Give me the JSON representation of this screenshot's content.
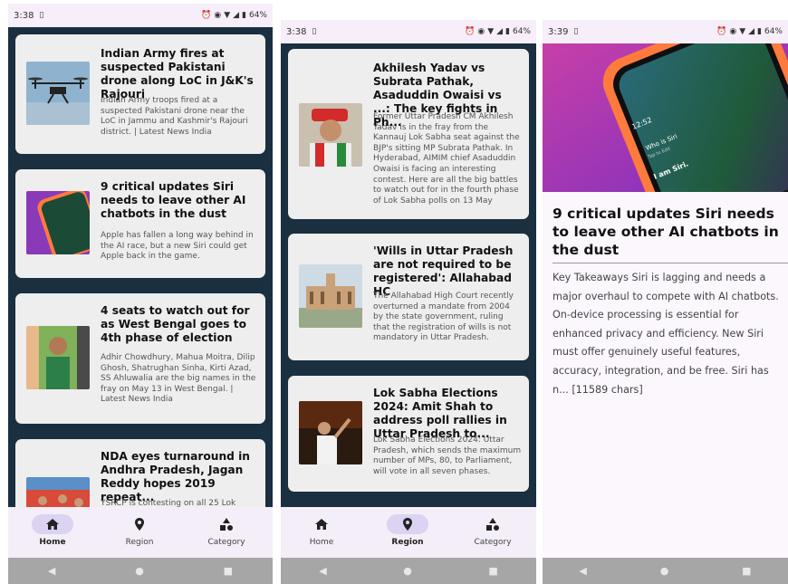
{
  "screens": [
    {
      "status": {
        "time": "3:38",
        "battery": "64%"
      },
      "articles": [
        {
          "title": "Indian Army fires at suspected Pakistani drone along LoC in J&K's Rajouri",
          "desc": "Indian Army troops fired at a suspected Pakistani drone near the LoC in Jammu and Kashmir's Rajouri district. | Latest News India"
        },
        {
          "title": "9 critical updates Siri needs to leave other AI chatbots in the dust",
          "desc": "Apple has fallen a long way behind in the AI race, but a new Siri could get Apple back in the game."
        },
        {
          "title": "4 seats to watch out for as West Bengal goes to 4th phase of election",
          "desc": "Adhir Chowdhury, Mahua Moitra, Dilip Ghosh, Shatrughan Sinha, Kirti Azad, SS Ahluwalia are the big names in the fray on May 13 in West Bengal. | Latest News India"
        },
        {
          "title": "NDA eyes turnaround in Andhra Pradesh, Jagan Reddy hopes 2019 repeat...",
          "desc": "YSRCP is contesting on all 25 Lok"
        }
      ],
      "nav": [
        "Home",
        "Region",
        "Category"
      ],
      "active": 0
    },
    {
      "status": {
        "time": "3:38",
        "battery": "64%"
      },
      "articles": [
        {
          "title": "Akhilesh Yadav vs Subrata Pathak, Asaduddin Owaisi vs ...: The key fights in Ph...",
          "desc": "Former Uttar Pradesh CM Akhilesh Yadav is in the fray from the Kannauj Lok Sabha seat against the BJP's sitting MP Subrata Pathak. In Hyderabad, AIMIM chief Asaduddin Owaisi is facing an interesting contest. Here are all the big battles to watch out for in the fourth phase of Lok Sabha polls on 13 May"
        },
        {
          "title": "'Wills in Uttar Pradesh are not required to be registered': Allahabad HC",
          "desc": "The Allahabad High Court recently overturned a mandate from 2004 by the state government, ruling that the registration of wills is not mandatory in Uttar Pradesh."
        },
        {
          "title": "Lok Sabha Elections 2024: Amit Shah to address poll rallies in Uttar Pradesh to...",
          "desc": "Lok Sabha Elections 2024: Uttar Pradesh, which sends the maximum number of MPs, 80, to Parliament, will vote in all seven phases."
        }
      ],
      "nav": [
        "Home",
        "Region",
        "Category"
      ],
      "active": 1
    },
    {
      "status": {
        "time": "3:39",
        "battery": "64%"
      },
      "article": {
        "title": "9 critical updates Siri needs to leave other AI chatbots in the dust",
        "body": "Key Takeaways Siri is lagging and needs a major overhaul to compete with AI chatbots. On-device processing is essential for enhanced privacy and efficiency. New Siri must offer genuinely useful features, accuracy, integration, and be free. Siri has n... [11589 chars]"
      },
      "image_text": {
        "line1": "Who is Siri",
        "line2": "Tap to Edit",
        "line3": "I am Siri.",
        "clock": "12:52"
      }
    }
  ],
  "icons": {
    "home": "home-icon",
    "region": "location-pin-icon",
    "category": "category-shapes-icon"
  },
  "colors": {
    "feed_bg": "#1a2f40",
    "card_bg": "#eeeeee",
    "nav_active_pill": "#dcd3f2"
  }
}
